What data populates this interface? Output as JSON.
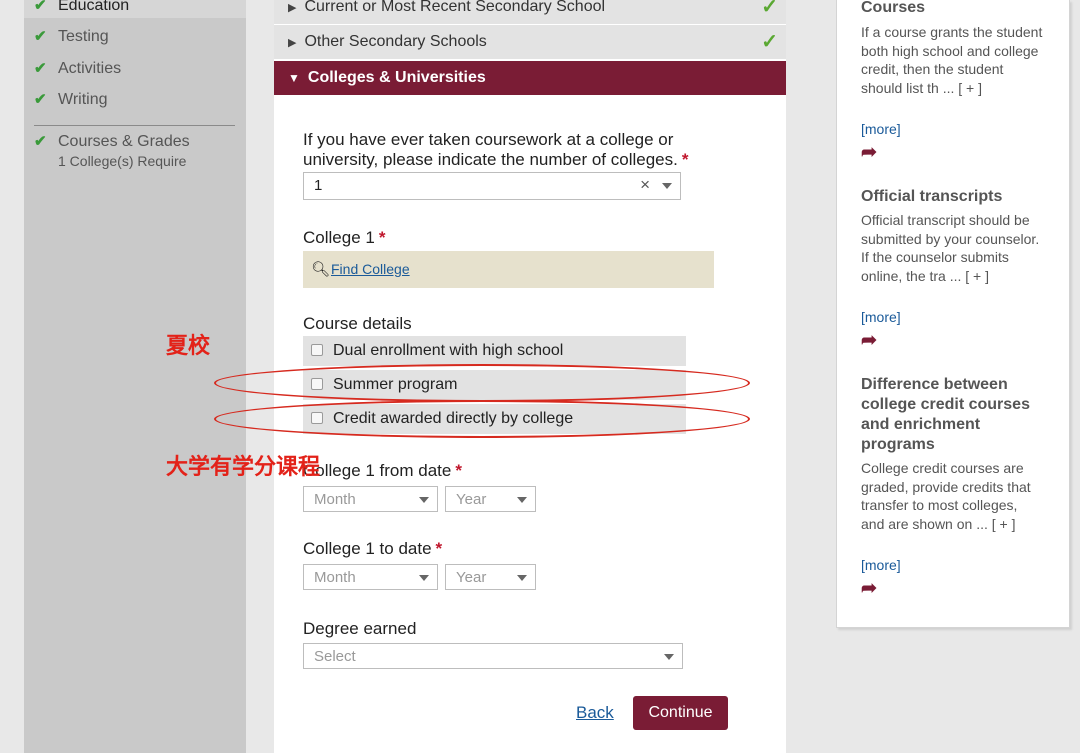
{
  "sidebar": {
    "items": [
      {
        "label": "Education",
        "checked": true,
        "active": true
      },
      {
        "label": "Testing",
        "checked": true
      },
      {
        "label": "Activities",
        "checked": true
      },
      {
        "label": "Writing",
        "checked": true
      },
      {
        "label": "Courses & Grades",
        "checked": true
      }
    ],
    "courses_sub": "1 College(s) Require"
  },
  "sections": {
    "current_school": "Current or Most Recent Secondary School",
    "other_schools": "Other Secondary Schools",
    "colleges": "Colleges & Universities"
  },
  "form": {
    "num_colleges_label": "If you have ever taken coursework at a college or university, please indicate the number of colleges.",
    "num_colleges_value": "1",
    "college1_label": "College 1",
    "find_college": "Find College",
    "course_details_label": "Course details",
    "course_options": [
      "Dual enrollment with high school",
      "Summer program",
      "Credit awarded directly by college"
    ],
    "from_date_label": "College 1 from date",
    "to_date_label": "College 1 to date",
    "month_placeholder": "Month",
    "year_placeholder": "Year",
    "degree_label": "Degree earned",
    "degree_placeholder": "Select",
    "required_mark": "*",
    "back": "Back",
    "continue": "Continue"
  },
  "annotations": {
    "summer": "夏校",
    "college_credit": "大学有学分课程"
  },
  "help": {
    "courses_title": "Courses",
    "courses_text": "If a course grants the student both high school and college credit, then the student should list th ... [ + ]",
    "official_title": "Official transcripts",
    "official_text": "Official transcript should be submitted by your counselor. If the counselor submits online, the tra ... [ + ]",
    "difference_title": "Difference between college credit courses and enrichment programs",
    "difference_text": "College credit courses are graded, provide credits that transfer to most colleges, and are shown on ... [ + ]",
    "more": "[more]"
  },
  "colors": {
    "accent": "#7a1c35",
    "check_green": "#5aa832",
    "annotation_red": "#d62a1f"
  },
  "icons": {
    "check": "check-icon",
    "search": "search-icon",
    "share": "share-icon",
    "caret": "caret-down-icon",
    "clear": "clear-icon"
  }
}
